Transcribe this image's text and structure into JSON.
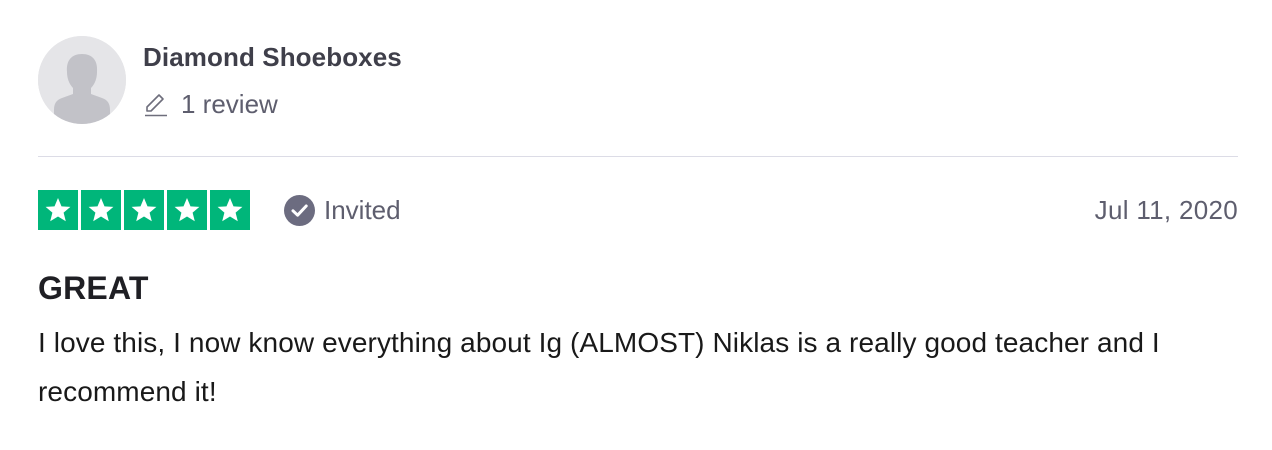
{
  "consumer": {
    "name": "Diamond Shoeboxes",
    "review_count": "1 review",
    "avatar_icon": "default-user-avatar-icon",
    "pencil_icon": "pencil-icon"
  },
  "review": {
    "rating": 5,
    "max_rating": 5,
    "star_color": "#00b67a",
    "verification_label": "Invited",
    "verification_icon": "check-circle-icon",
    "date": "Jul 11, 2020",
    "title": "GREAT",
    "text": "I love this, I now know everything about Ig (ALMOST) Niklas is a really good teacher and I recommend it!"
  }
}
